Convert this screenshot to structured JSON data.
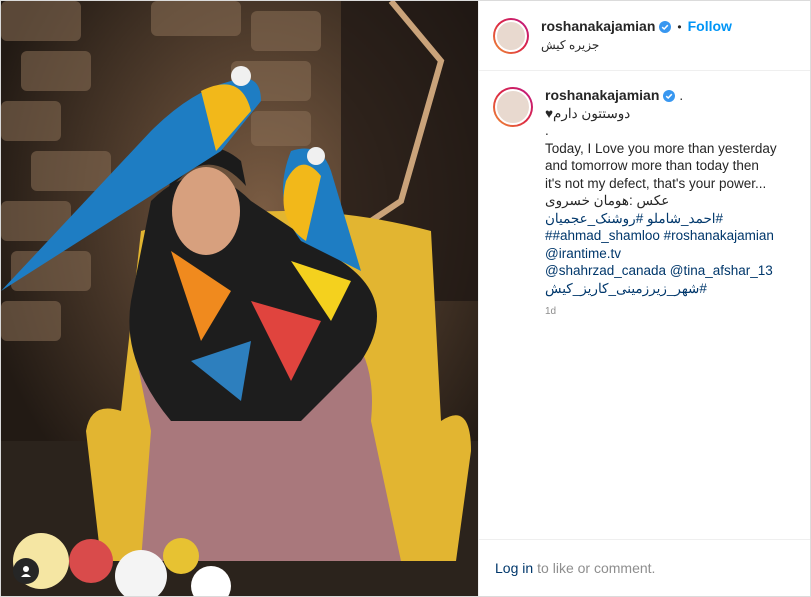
{
  "post": {
    "username": "roshanakajamian",
    "follow_label": "Follow",
    "dot": "•",
    "location": "جزیره کیش",
    "caption": {
      "line1": "♥دوستتون دارم",
      "line2": ".",
      "line3": "Today, I Love you more than yesterday",
      "line4": "and tomorrow more than today then",
      "line5": "it's not my defect, that's your power...",
      "line6": "عکس :هومان خسروی",
      "line7": "احمد_شاملو #روشنک_عجمیان#",
      "line8": "##ahmad_shamloo #roshanakajamian",
      "line9": "@irantime.tv",
      "line10": "@shahrzad_canada @tina_afshar_13",
      "line11": "شهر_زیرزمینی_کاریز_کیش#",
      "tail": "1d"
    },
    "footer": {
      "login_label": "Log in",
      "rest_text": "to like or comment."
    }
  },
  "icons": {
    "verified": "verified-badge-icon",
    "user_tag": "user-tag-icon"
  },
  "colors": {
    "link": "#00376b",
    "follow": "#0095f6",
    "verified": "#3897f0"
  }
}
